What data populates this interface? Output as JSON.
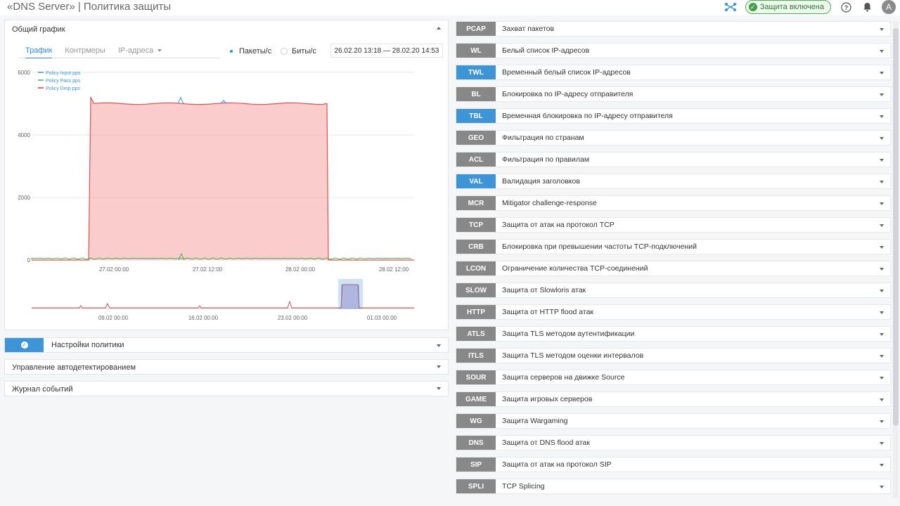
{
  "header": {
    "title": "«DNS Server» | Политика защиты",
    "status_text": "Защита включена",
    "avatar_letter": "A"
  },
  "graph_panel": {
    "title": "Общий график",
    "tabs": [
      {
        "label": "Трафик",
        "active": true
      },
      {
        "label": "Контрмеры",
        "active": false
      },
      {
        "label": "IP-адреса",
        "active": false
      }
    ],
    "radio": [
      {
        "label": "Пакеты/с",
        "selected": true
      },
      {
        "label": "Биты/с",
        "selected": false
      }
    ],
    "date_range": "26.02.20 13:18 — 28.02.20 14:53"
  },
  "chart_data": {
    "type": "area",
    "ylim": [
      0,
      6000
    ],
    "yticks": [
      "6000",
      "4000",
      "2000",
      "0"
    ],
    "xticks": [
      "27.02 00:00",
      "27.02 12:00",
      "28.02 00:00",
      "28.02 12:00"
    ],
    "legend_placement": "top-left",
    "series": [
      {
        "name": "Policy Input pps",
        "color": "#3d95d8"
      },
      {
        "name": "Policy Pass pps",
        "color": "#4caf50"
      },
      {
        "name": "Policy Drop pps",
        "color": "#e53935"
      }
    ],
    "drop_level": 5000,
    "drop_spike": 5200,
    "input_spikes": [
      5200,
      5100
    ],
    "pass_spike": 200,
    "navigator_xticks": [
      "09.02 00:00",
      "16.02 00:00",
      "23.02 00:00",
      "01.03 00:00"
    ]
  },
  "panels": {
    "policy_settings": "Настройки политики",
    "autodetect": "Управление автодетектированием",
    "event_log": "Журнал событий"
  },
  "countermeasures": [
    {
      "code": "PCAP",
      "label": "Захват пакетов",
      "active": false
    },
    {
      "code": "WL",
      "label": "Белый список IP-адресов",
      "active": false
    },
    {
      "code": "TWL",
      "label": "Временный белый список IP-адресов",
      "active": true
    },
    {
      "code": "BL",
      "label": "Блокировка по IP-адресу отправителя",
      "active": false
    },
    {
      "code": "TBL",
      "label": "Временная блокировка по IP-адресу отправителя",
      "active": true
    },
    {
      "code": "GEO",
      "label": "Фильтрация по странам",
      "active": false
    },
    {
      "code": "ACL",
      "label": "Фильтрация по правилам",
      "active": false
    },
    {
      "code": "VAL",
      "label": "Валидация заголовков",
      "active": true
    },
    {
      "code": "MCR",
      "label": "Mitigator challenge-response",
      "active": false
    },
    {
      "code": "TCP",
      "label": "Защита от атак на протокол TCP",
      "active": false
    },
    {
      "code": "CRB",
      "label": "Блокировка при превышении частоты TCP-подключений",
      "active": false
    },
    {
      "code": "LCON",
      "label": "Ограничение количества TCP-соединений",
      "active": false
    },
    {
      "code": "SLOW",
      "label": "Защита от Slowloris атак",
      "active": false
    },
    {
      "code": "HTTP",
      "label": "Защита от HTTP flood атак",
      "active": false
    },
    {
      "code": "ATLS",
      "label": "Защита TLS методом аутентификации",
      "active": false
    },
    {
      "code": "ITLS",
      "label": "Защита TLS методом оценки интервалов",
      "active": false
    },
    {
      "code": "SOUR",
      "label": "Защита серверов на движке Source",
      "active": false
    },
    {
      "code": "GAME",
      "label": "Защита игровых серверов",
      "active": false
    },
    {
      "code": "WG",
      "label": "Защита Wargaming",
      "active": false
    },
    {
      "code": "DNS",
      "label": "Защита от DNS flood атак",
      "active": false
    },
    {
      "code": "SIP",
      "label": "Защита от атак на протокол SIP",
      "active": false
    },
    {
      "code": "SPLI",
      "label": "TCP Splicing",
      "active": false
    }
  ]
}
